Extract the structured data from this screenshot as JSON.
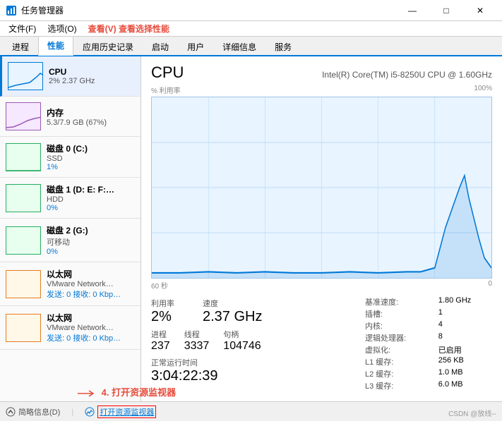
{
  "window": {
    "title": "任务管理器",
    "controls": [
      "—",
      "□",
      "×"
    ]
  },
  "menubar": {
    "items": [
      "文件(F)",
      "选项(O)",
      "查看(V)"
    ]
  },
  "annotation_top": "查看选择性能",
  "tabs": {
    "items": [
      "进程",
      "性能",
      "应用历史记录",
      "启动",
      "用户",
      "详细信息",
      "服务"
    ],
    "active": 1
  },
  "sidebar": {
    "items": [
      {
        "name": "CPU",
        "sub": "2% 2.37 GHz",
        "value": "",
        "color": "#0078d7",
        "active": true
      },
      {
        "name": "内存",
        "sub": "5.3/7.9 GB (67%)",
        "value": "",
        "color": "#9b59b6",
        "active": false
      },
      {
        "name": "磁盘 0 (C:)",
        "sub": "SSD",
        "value": "1%",
        "color": "#27ae60",
        "active": false
      },
      {
        "name": "磁盘 1 (D: E: F:…",
        "sub": "HDD",
        "value": "0%",
        "color": "#27ae60",
        "active": false
      },
      {
        "name": "磁盘 2 (G:)",
        "sub": "可移动",
        "value": "0%",
        "color": "#27ae60",
        "active": false
      },
      {
        "name": "以太网",
        "sub": "VMware Network…",
        "value": "发送: 0  接收: 0 Kbp…",
        "color": "#e67e22",
        "active": false
      },
      {
        "name": "以太网",
        "sub": "VMware Network…",
        "value": "发送: 0  接收: 0 Kbp…",
        "color": "#e67e22",
        "active": false
      }
    ]
  },
  "cpu_panel": {
    "title": "CPU",
    "subtitle": "Intel(R) Core(TM) i5-8250U CPU @ 1.60GHz",
    "chart_label_left": "% 利用率",
    "chart_label_right": "100%",
    "chart_time_left": "60 秒",
    "chart_time_right": "0",
    "stats": {
      "utilization_label": "利用率",
      "utilization_value": "2%",
      "speed_label": "速度",
      "speed_value": "2.37 GHz",
      "processes_label": "进程",
      "processes_value": "237",
      "threads_label": "线程",
      "threads_value": "3337",
      "handles_label": "句柄",
      "handles_value": "104746",
      "uptime_label": "正常运行时间",
      "uptime_value": "3:04:22:39"
    },
    "info": {
      "base_speed_label": "基准速度:",
      "base_speed_value": "1.80 GHz",
      "slots_label": "插槽:",
      "slots_value": "1",
      "cores_label": "内核:",
      "cores_value": "4",
      "logical_label": "逻辑处理器:",
      "logical_value": "8",
      "virtualization_label": "虚拟化:",
      "virtualization_value": "已启用",
      "l1_label": "L1 缓存:",
      "l1_value": "256 KB",
      "l2_label": "L2 缓存:",
      "l2_value": "1.0 MB",
      "l3_label": "L3 缓存:",
      "l3_value": "6.0 MB"
    }
  },
  "bottom_bar": {
    "collapse_label": "简略信息(D)",
    "open_monitor_label": "打开资源监视器",
    "annotation": "4. 打开资源监视器"
  },
  "watermark": "CSDN @放线--"
}
